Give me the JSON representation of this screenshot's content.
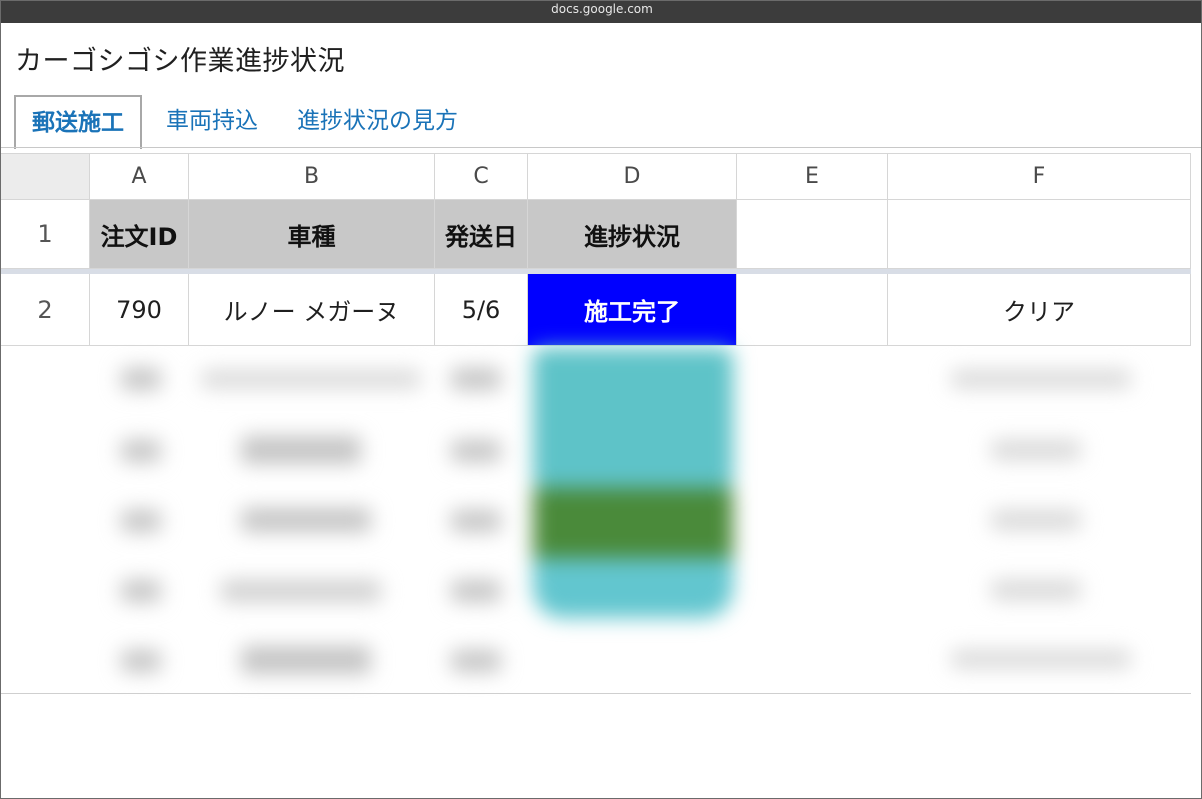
{
  "browser": {
    "url": "docs.google.com"
  },
  "document": {
    "title": "カーゴシゴシ作業進捗状況"
  },
  "tabs": [
    {
      "label": "郵送施工",
      "active": true
    },
    {
      "label": "車両持込",
      "active": false
    },
    {
      "label": "進捗状況の見方",
      "active": false
    }
  ],
  "columns": [
    "A",
    "B",
    "C",
    "D",
    "E",
    "F"
  ],
  "rows": [
    {
      "num": "1",
      "cells": [
        "注文ID",
        "車種",
        "発送日",
        "進捗状況",
        "",
        ""
      ]
    },
    {
      "num": "2",
      "cells": [
        "790",
        "ルノー メガーヌ",
        "5/6",
        "施工完了",
        "",
        "クリア"
      ]
    }
  ],
  "colors": {
    "status_done": "#0000ff",
    "header_bg": "#c8c8c8",
    "tab_link": "#1a73b8",
    "blurred_status_1": "#5ec3c8",
    "blurred_status_2": "#4a8a3a"
  }
}
